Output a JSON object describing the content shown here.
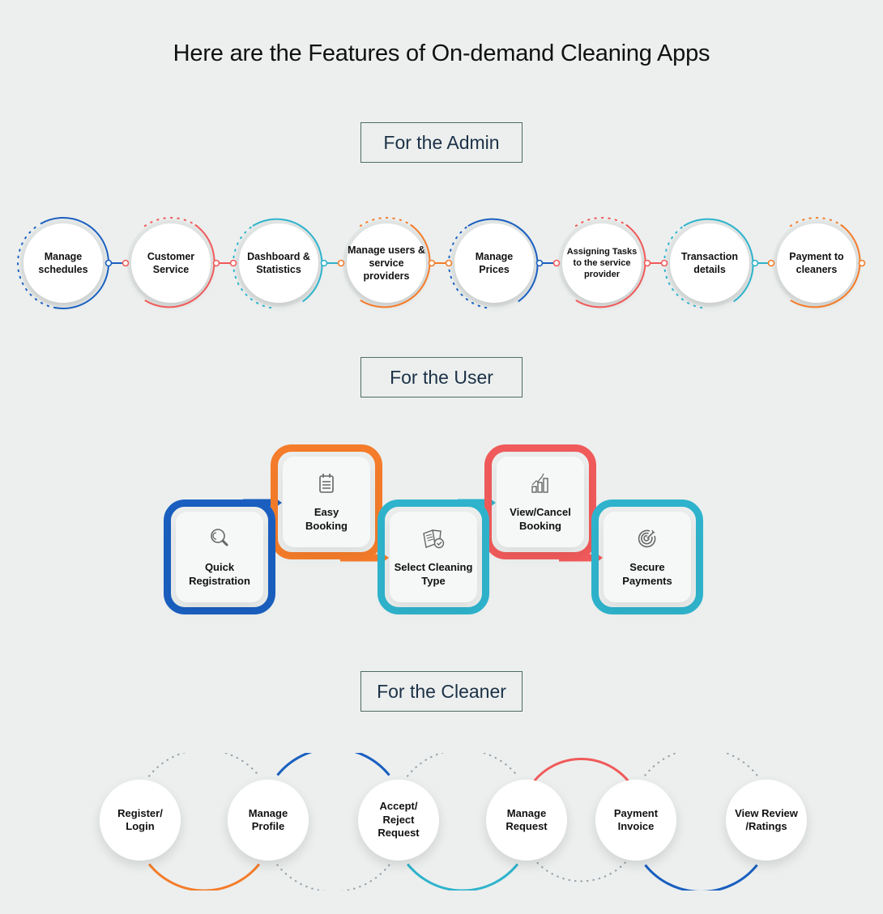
{
  "title": "Here are the Features of On-demand Cleaning Apps",
  "colors": {
    "background": "#ecefee",
    "blue": "#1a5fbf",
    "red": "#f05a5a",
    "teal": "#2fb3cc",
    "orange": "#f47c2a",
    "gray_dots": "#9aa4ad",
    "label_border": "#4f6b66",
    "label_text": "#1c3147"
  },
  "sections": {
    "admin": {
      "label": "For the Admin",
      "features": [
        {
          "line1": "Manage",
          "line2": "schedules",
          "line3": "",
          "color": "blue"
        },
        {
          "line1": "Customer",
          "line2": "Service",
          "line3": "",
          "color": "red"
        },
        {
          "line1": "Dashboard &",
          "line2": "Statistics",
          "line3": "",
          "color": "teal"
        },
        {
          "line1": "Manage users &",
          "line2": "service providers",
          "line3": "",
          "color": "orange"
        },
        {
          "line1": "Manage",
          "line2": "Prices",
          "line3": "",
          "color": "blue"
        },
        {
          "line1": "Assigning Tasks",
          "line2": "to the service",
          "line3": "provider",
          "color": "red"
        },
        {
          "line1": "Transaction",
          "line2": "details",
          "line3": "",
          "color": "teal"
        },
        {
          "line1": "Payment to",
          "line2": "cleaners",
          "line3": "",
          "color": "orange"
        }
      ]
    },
    "user": {
      "label": "For the User",
      "steps": [
        {
          "line1": "Quick",
          "line2": "Registration",
          "icon": "search-icon",
          "color": "blue"
        },
        {
          "line1": "Easy",
          "line2": "Booking",
          "icon": "notepad-icon",
          "color": "orange"
        },
        {
          "line1": "Select Cleaning",
          "line2": "Type",
          "icon": "book-check-icon",
          "color": "teal"
        },
        {
          "line1": "View/Cancel",
          "line2": "Booking",
          "icon": "bar-chart-icon",
          "color": "red"
        },
        {
          "line1": "Secure",
          "line2": "Payments",
          "icon": "target-icon",
          "color": "teal"
        }
      ]
    },
    "cleaner": {
      "label": "For the Cleaner",
      "features": [
        {
          "line1": "Register/",
          "line2": "Login",
          "line3": ""
        },
        {
          "line1": "Manage",
          "line2": "Profile",
          "line3": ""
        },
        {
          "line1": "Accept/",
          "line2": "Reject",
          "line3": "Request"
        },
        {
          "line1": "Manage",
          "line2": "Request",
          "line3": ""
        },
        {
          "line1": "Payment",
          "line2": "Invoice",
          "line3": ""
        },
        {
          "line1": "View Review",
          "line2": "/Ratings",
          "line3": ""
        }
      ]
    }
  }
}
